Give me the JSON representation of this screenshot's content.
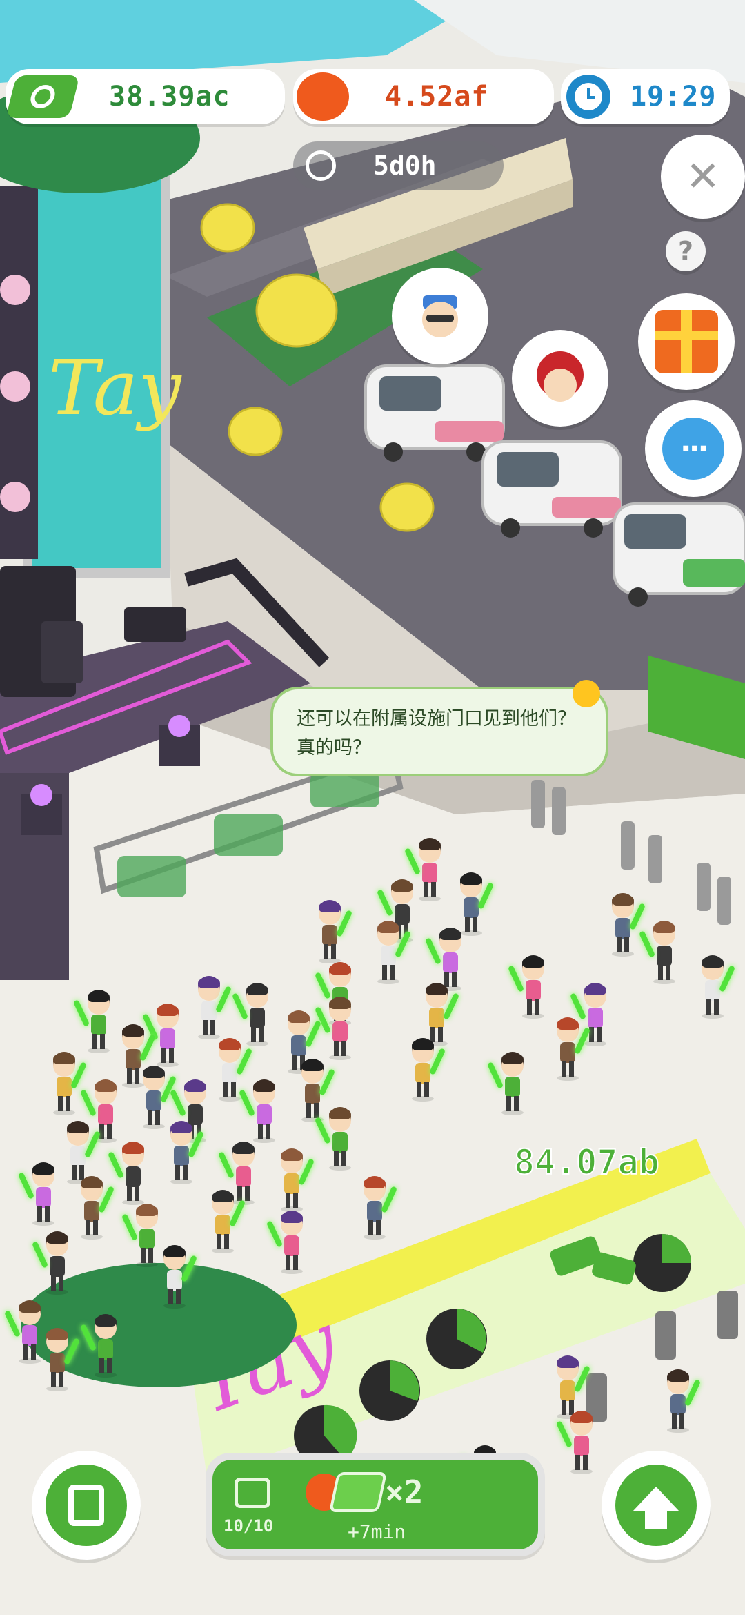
{
  "hud": {
    "cash_value": "38.39ac",
    "fruit_value": "4.52af",
    "clock_value": "19:29",
    "event_timer": "5d0h"
  },
  "speech_bubble_text": "还可以在附属设施门口见到他们？真的吗？",
  "floating_income": "84.07ab",
  "booster": {
    "ad_count": "10/10",
    "multiplier": "×2",
    "duration": "+7min"
  },
  "banner_text": "Tay",
  "side_buttons": [
    "close",
    "help",
    "gift",
    "chat"
  ],
  "colors": {
    "accent_green": "#4db038",
    "cash_text": "#2e8b3a",
    "fruit_text": "#d64a1c",
    "clock_text": "#1e88c9",
    "stage_pink": "#e25bd8"
  }
}
